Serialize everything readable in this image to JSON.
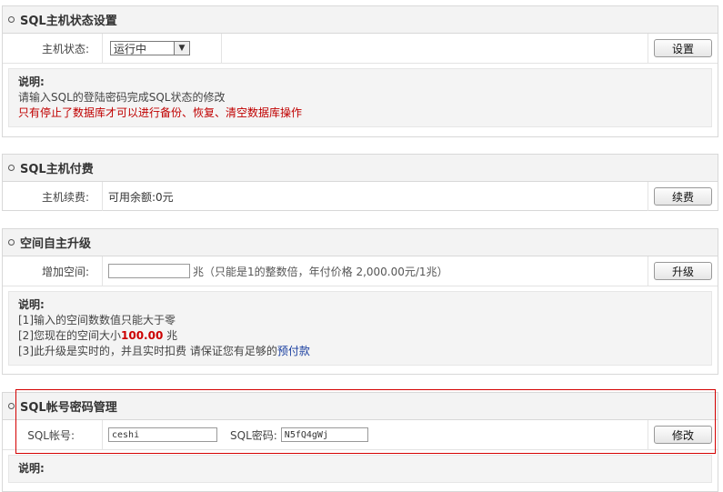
{
  "status_panel": {
    "title": "SQL主机状态设置",
    "label": "主机状态:",
    "select_value": "运行中",
    "button": "设置",
    "note_title": "说明:",
    "note_line1": "请输入SQL的登陆密码完成SQL状态的修改",
    "note_line2": "只有停止了数据库才可以进行备份、恢复、清空数据库操作"
  },
  "pay_panel": {
    "title": "SQL主机付费",
    "label": "主机续费:",
    "balance": "可用余额:0元",
    "button": "续费"
  },
  "upgrade_panel": {
    "title": "空间自主升级",
    "label": "增加空间:",
    "input_value": "",
    "hint": "兆（只能是1的整数倍，年付价格 2,000.00元/1兆）",
    "button": "升级",
    "note_title": "说明:",
    "note_line1": "[1]输入的空间数数值只能大于零",
    "note_line2_prefix": "[2]您现在的空间大小",
    "current_size": "100.00",
    "note_line2_suffix": "兆",
    "note_line3_prefix": "[3]此升级是实时的，并且实时扣费 请保证您有足够的",
    "note_line3_link": "预付款"
  },
  "account_panel": {
    "title": "SQL帐号密码管理",
    "account_label": "SQL帐号:",
    "account_value": "ceshi",
    "password_label": "SQL密码:",
    "password_value": "N5fQ4gWj",
    "button": "修改",
    "note_title": "说明:"
  },
  "colors": {
    "highlight": "#d40000",
    "warning_text": "#c00000",
    "link": "#1a3fa0"
  }
}
